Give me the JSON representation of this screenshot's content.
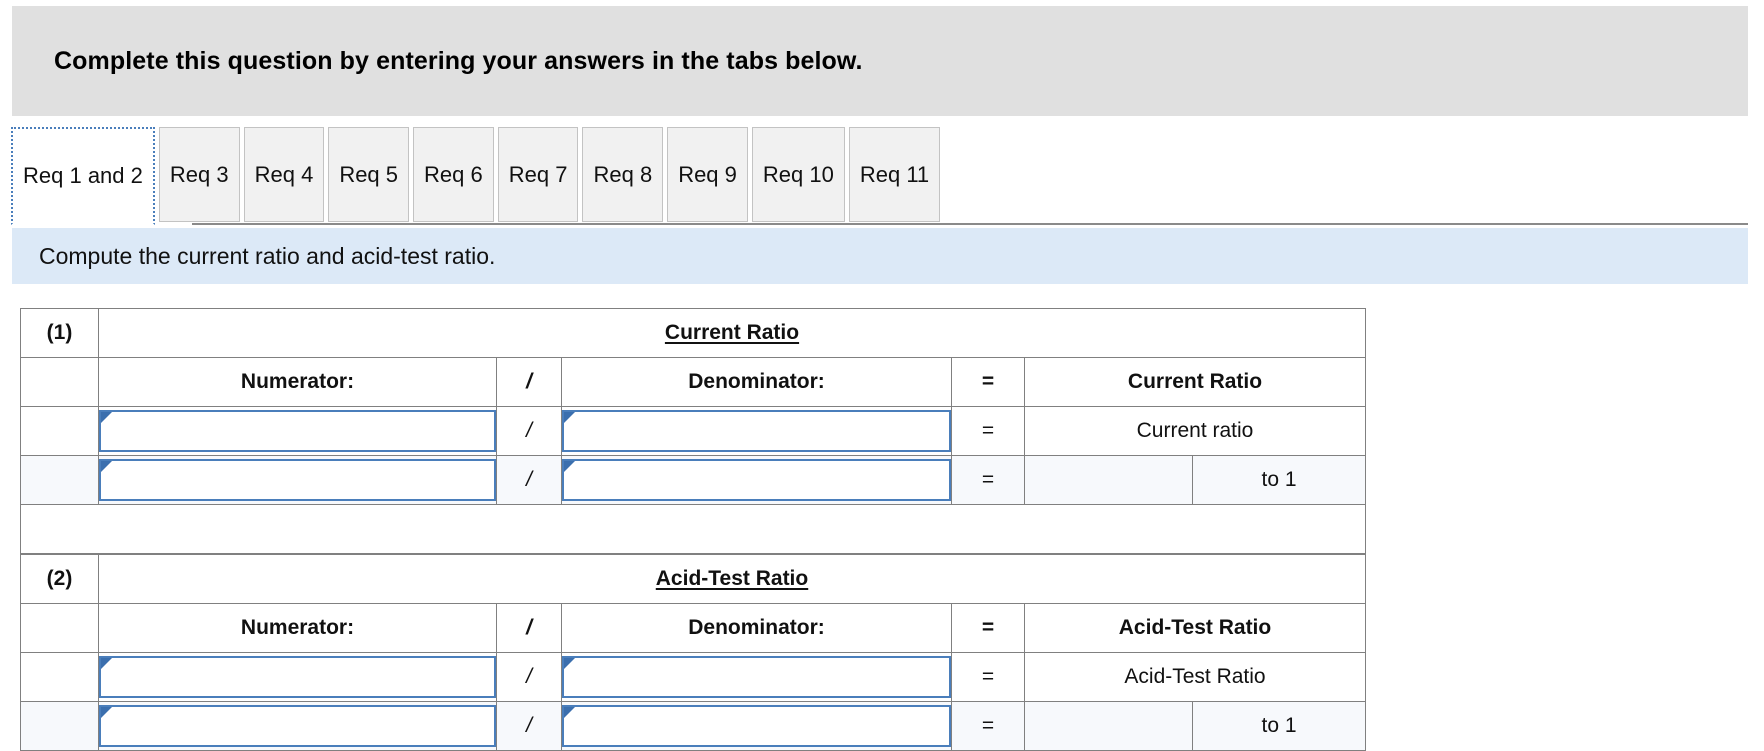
{
  "banner": {
    "text": "Complete this question by entering your answers in the tabs below."
  },
  "tabs": {
    "active_index": 0,
    "items": [
      {
        "label": "Req 1 and 2",
        "active": true
      },
      {
        "label": "Req 3",
        "active": false
      },
      {
        "label": "Req 4",
        "active": false
      },
      {
        "label": "Req 5",
        "active": false
      },
      {
        "label": "Req 6",
        "active": false
      },
      {
        "label": "Req 7",
        "active": false
      },
      {
        "label": "Req 8",
        "active": false
      },
      {
        "label": "Req 9",
        "active": false
      },
      {
        "label": "Req 10",
        "active": false
      },
      {
        "label": "Req 11",
        "active": false
      }
    ]
  },
  "prompt": {
    "text": "Compute the current ratio and acid-test ratio."
  },
  "colors": {
    "banner_bg": "#e0e0e0",
    "prompt_bg": "#dce9f7",
    "header_blue": "#85aade",
    "input_border": "#4a7ebb",
    "grid_line": "#808080",
    "alt_row": "#f7f9fc",
    "tab_bg": "#f1f1f1"
  },
  "sections": [
    {
      "index_label": "(1)",
      "title": "Current Ratio",
      "columns": {
        "numerator": "Numerator:",
        "slash": "/",
        "denominator": "Denominator:",
        "equals": "=",
        "result": "Current Ratio"
      },
      "rows": [
        {
          "numerator_value": "",
          "slash": "/",
          "denominator_value": "",
          "equals": "=",
          "result_label": "Current ratio",
          "result_split": false
        },
        {
          "numerator_value": "",
          "slash": "/",
          "denominator_value": "",
          "equals": "=",
          "result_value": "",
          "result_suffix": "to 1",
          "result_split": true
        }
      ]
    },
    {
      "index_label": "(2)",
      "title": "Acid-Test Ratio",
      "columns": {
        "numerator": "Numerator:",
        "slash": "/",
        "denominator": "Denominator:",
        "equals": "=",
        "result": "Acid-Test Ratio"
      },
      "rows": [
        {
          "numerator_value": "",
          "slash": "/",
          "denominator_value": "",
          "equals": "=",
          "result_label": "Acid-Test Ratio",
          "result_split": false
        },
        {
          "numerator_value": "",
          "slash": "/",
          "denominator_value": "",
          "equals": "=",
          "result_value": "",
          "result_suffix": "to 1",
          "result_split": true
        }
      ]
    }
  ]
}
